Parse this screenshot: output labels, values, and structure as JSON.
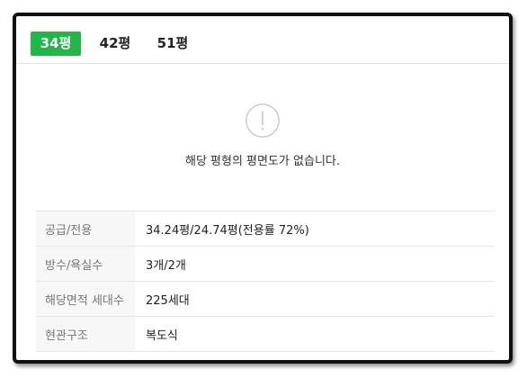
{
  "tabs": [
    {
      "label": "34평",
      "active": true
    },
    {
      "label": "42평",
      "active": false
    },
    {
      "label": "51평",
      "active": false
    }
  ],
  "floorplan": {
    "icon": "exclamation-circle-icon",
    "empty_message": "해당 평형의 평면도가 없습니다."
  },
  "details": [
    {
      "label": "공급/전용",
      "value": "34.24평/24.74평(전용률 72%)"
    },
    {
      "label": "방수/욕실수",
      "value": "3개/2개"
    },
    {
      "label": "해당면적 세대수",
      "value": "225세대"
    },
    {
      "label": "현관구조",
      "value": "복도식"
    }
  ],
  "colors": {
    "active_tab": "#20b648",
    "frame_border": "#111111"
  }
}
